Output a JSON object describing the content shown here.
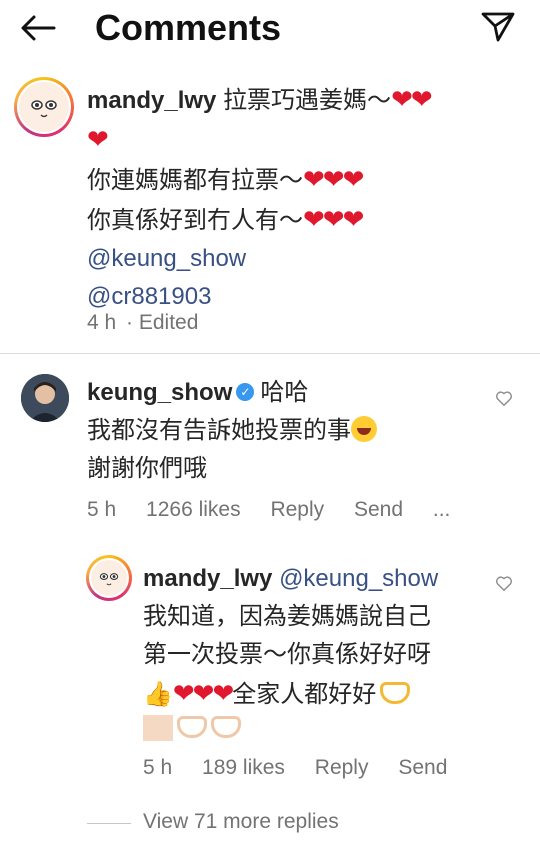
{
  "header": {
    "title": "Comments",
    "back_icon": "back-arrow-icon",
    "share_icon": "paper-plane-icon"
  },
  "comment1": {
    "username": "mandy_lwy",
    "line1": "拉票巧遇姜媽〜",
    "hearts1": "❤❤",
    "hearts1b": "❤",
    "line2": "你連媽媽都有拉票〜",
    "hearts2": "❤❤❤",
    "line3": "你真係好到冇人有〜",
    "hearts3": "❤❤❤",
    "mention1": "@keung_show",
    "mention2": "@cr881903",
    "time": "4 h",
    "edited": "· Edited"
  },
  "comment2": {
    "username": "keung_show",
    "verified_mark": "✓",
    "line1": "哈哈",
    "line2": "我都沒有告訴她投票的事",
    "line3": "謝謝你們哦",
    "time": "5 h",
    "likes": "1266 likes",
    "reply": "Reply",
    "send": "Send",
    "more": "..."
  },
  "reply1": {
    "username": "mandy_lwy",
    "mention": "@keung_show",
    "line1": "我知道，因為姜媽媽說自己",
    "line2": "第一次投票〜你真係好好呀",
    "hearts": "❤❤❤",
    "line3": "全家人都好好",
    "time": "5 h",
    "likes": "189 likes",
    "reply": "Reply",
    "send": "Send"
  },
  "footer": {
    "view_more": "View 71 more replies"
  },
  "colors": {
    "heart": "#e0182d",
    "mention": "#385185",
    "meta": "#737373",
    "verified": "#3897f0"
  }
}
